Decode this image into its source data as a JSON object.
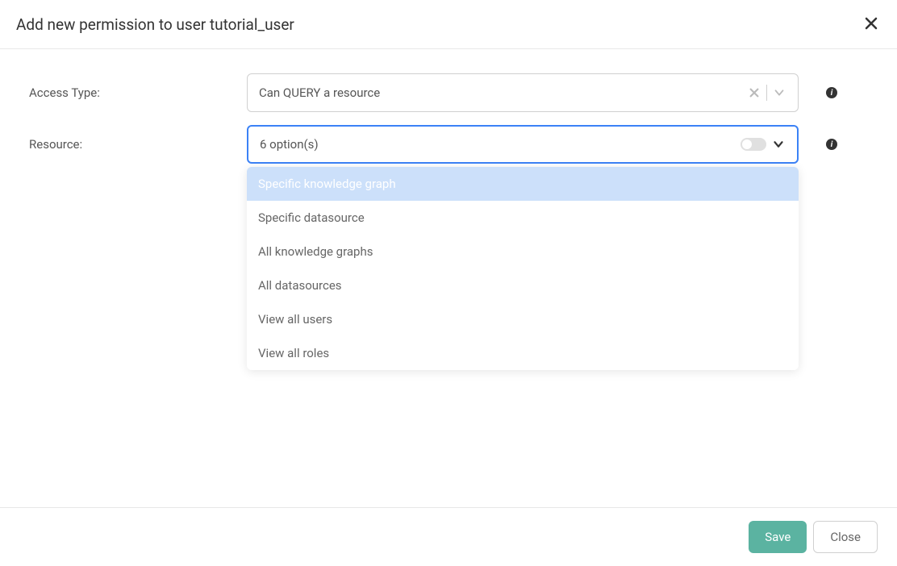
{
  "header": {
    "title": "Add new permission to user tutorial_user"
  },
  "form": {
    "access_type": {
      "label": "Access Type:",
      "value": "Can QUERY a resource"
    },
    "resource": {
      "label": "Resource:",
      "placeholder": "6 option(s)",
      "options": [
        "Specific knowledge graph",
        "Specific datasource",
        "All knowledge graphs",
        "All datasources",
        "View all users",
        "View all roles"
      ],
      "highlighted_index": 0
    }
  },
  "footer": {
    "save_label": "Save",
    "close_label": "Close"
  }
}
